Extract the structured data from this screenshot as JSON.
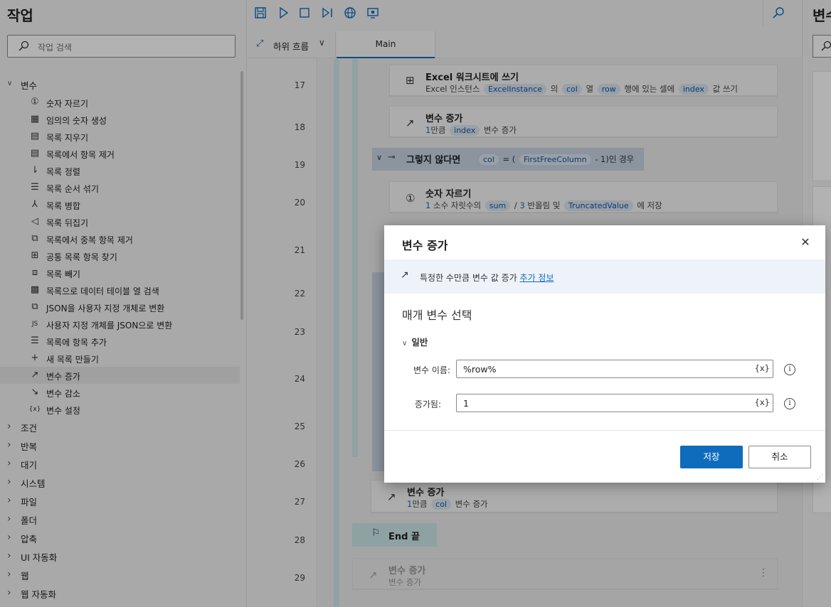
{
  "left_panel": {
    "title": "작업",
    "search_placeholder": "작업 검색",
    "variables_group": "변수",
    "items": [
      {
        "label": "숫자 자르기",
        "icon": "truncate-number-icon",
        "glyph": "①"
      },
      {
        "label": "임의의 숫자 생성",
        "icon": "random-number-icon",
        "glyph": "▦"
      },
      {
        "label": "목록 지우기",
        "icon": "clear-list-icon",
        "glyph": "▤"
      },
      {
        "label": "목록에서 항목 제거",
        "icon": "remove-item-icon",
        "glyph": "▤"
      },
      {
        "label": "목록 정렬",
        "icon": "sort-list-icon",
        "glyph": "⇂"
      },
      {
        "label": "목록 순서 섞기",
        "icon": "shuffle-list-icon",
        "glyph": "☰"
      },
      {
        "label": "목록 병합",
        "icon": "merge-list-icon",
        "glyph": "⅄"
      },
      {
        "label": "목록 뒤집기",
        "icon": "reverse-list-icon",
        "glyph": "◁"
      },
      {
        "label": "목록에서 중복 항목 제거",
        "icon": "remove-duplicates-icon",
        "glyph": "⧉"
      },
      {
        "label": "공통 목록 항목 찾기",
        "icon": "common-items-icon",
        "glyph": "⊞"
      },
      {
        "label": "목록 빼기",
        "icon": "subtract-list-icon",
        "glyph": "⧈"
      },
      {
        "label": "목록으로 데이터 테이블 열 검색",
        "icon": "datatable-column-icon",
        "glyph": "▩"
      },
      {
        "label": "JSON을 사용자 지정 개체로 변환",
        "icon": "json-to-object-icon",
        "glyph": "⧉"
      },
      {
        "label": "사용자 지정 개체를 JSON으로 변환",
        "icon": "object-to-json-icon",
        "glyph": "JS"
      },
      {
        "label": "목록에 항목 추가",
        "icon": "add-item-icon",
        "glyph": "☰"
      },
      {
        "label": "새 목록 만들기",
        "icon": "new-list-icon",
        "glyph": "+"
      },
      {
        "label": "변수 증가",
        "icon": "increase-variable-icon",
        "glyph": "↗"
      },
      {
        "label": "변수 감소",
        "icon": "decrease-variable-icon",
        "glyph": "↘"
      },
      {
        "label": "변수 설정",
        "icon": "set-variable-icon",
        "glyph": "{x}"
      }
    ],
    "groups": [
      "조건",
      "반복",
      "대기",
      "시스템",
      "파일",
      "폴더",
      "압축",
      "UI 자동화",
      "웹",
      "웹 자동화"
    ]
  },
  "toolbar": {
    "subflow_label": "하위 흐름",
    "tab_main": "Main"
  },
  "flow": {
    "line_numbers": [
      "17",
      "18",
      "19",
      "20",
      "21",
      "22",
      "23",
      "24",
      "25",
      "26",
      "27",
      "28",
      "29"
    ],
    "step17": {
      "title": "Excel 워크시트에 쓰기",
      "p1": "Excel 인스턴스",
      "v1": "ExcelInstance",
      "p2": "의",
      "v2": "col",
      "p3": "열",
      "v3": "row",
      "p4": "행에 있는 셀에",
      "v4": "index",
      "p5": "값 쓰기"
    },
    "step18": {
      "title": "변수 증가",
      "n": "1",
      "p1": "만큼",
      "v1": "index",
      "p2": "변수 증가"
    },
    "step19": {
      "title": "그렇지 않다면",
      "v1": "col",
      "p1": "= (",
      "v2": "FirstFreeColumn",
      "p2": "- 1)인 경우"
    },
    "step20": {
      "title": "숫자 자르기",
      "n1": "1",
      "p1": "소수 자릿수의",
      "v1": "sum",
      "p2": "/",
      "n2": "3",
      "p3": "반올림 및",
      "v2": "TruncatedValue",
      "p4": "에 저장"
    },
    "step27": {
      "title": "변수 증가",
      "n": "1",
      "p1": "만큼",
      "v1": "col",
      "p2": "변수 증가"
    },
    "step28": {
      "title": "End 끝"
    },
    "step29": {
      "title": "변수 증가",
      "desc": "변수 증가"
    }
  },
  "right_panel": {
    "title": "변수"
  },
  "dialog": {
    "title": "변수 증가",
    "info_text": "특정한 수만큼 변수 값 증가",
    "info_link": "추가 정보",
    "section": "매개 변수 선택",
    "group": "일반",
    "field1_label": "변수 이름:",
    "field1_value": "%row%",
    "field2_label": "증가됨:",
    "field2_value": "1",
    "var_button": "{x}",
    "save": "저장",
    "cancel": "취소"
  },
  "colors": {
    "accent": "#0f6cbd",
    "rail": "#cfe8ea",
    "else_bar": "#c7d4e4",
    "pill_bg": "#dbe6f1"
  }
}
